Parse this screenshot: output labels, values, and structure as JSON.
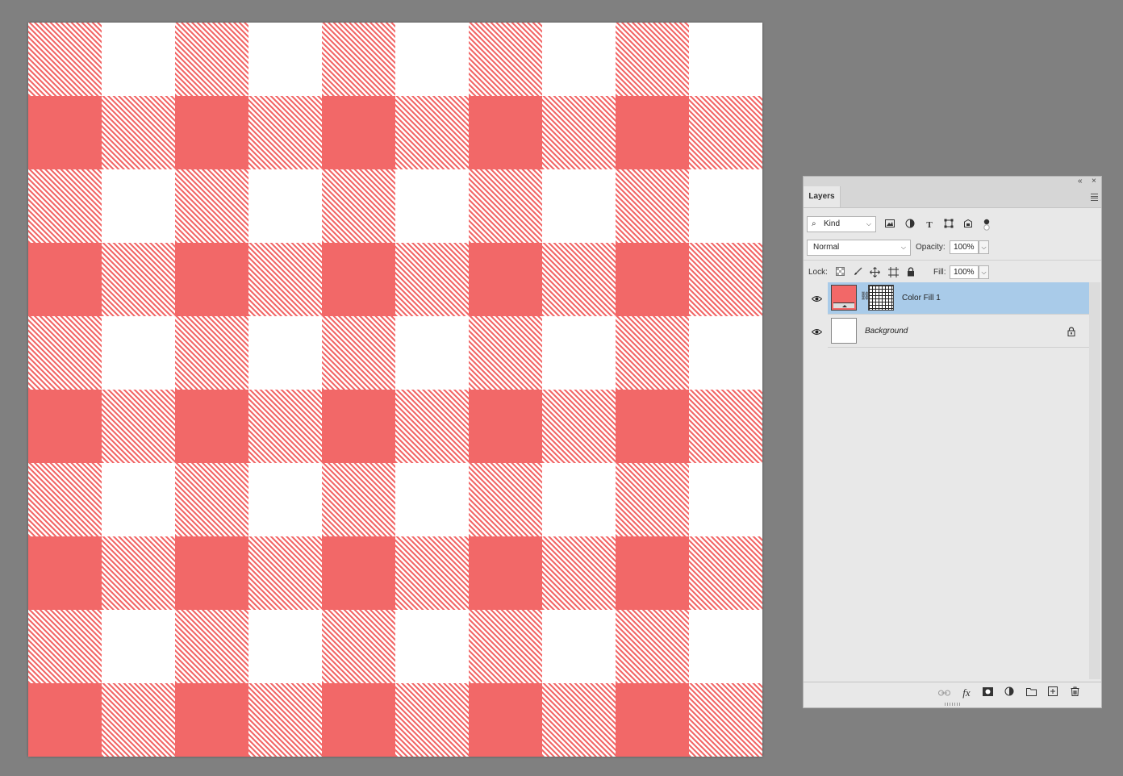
{
  "canvas": {
    "pattern": "gingham",
    "colors": {
      "fill": "#f26868",
      "background": "#ffffff"
    }
  },
  "panel": {
    "tab_label": "Layers",
    "collapse_icon": "double-chevron-left-icon",
    "close_icon": "close-icon",
    "menu_icon": "panel-menu-icon",
    "filter": {
      "kind_value": "Kind",
      "icons": [
        "image-filter-icon",
        "adjustment-filter-icon",
        "type-filter-icon",
        "shape-filter-icon",
        "smart-object-filter-icon",
        "filter-toggle-icon"
      ]
    },
    "blend_mode": "Normal",
    "opacity_label": "Opacity:",
    "opacity_value": "100%",
    "lock_label": "Lock:",
    "fill_label": "Fill:",
    "fill_value": "100%",
    "layers": [
      {
        "name": "Color Fill 1",
        "visible": true,
        "selected": true,
        "thumb_color": "#f26868",
        "has_mask": true,
        "italic": false
      },
      {
        "name": "Background",
        "visible": true,
        "selected": false,
        "thumb_color": "#ffffff",
        "locked": true,
        "italic": true
      }
    ],
    "bottom_icons": [
      "link-layers-icon",
      "fx-icon",
      "add-mask-icon",
      "new-adjustment-icon",
      "new-group-icon",
      "new-layer-icon",
      "delete-layer-icon"
    ],
    "fx_label": "fx"
  }
}
